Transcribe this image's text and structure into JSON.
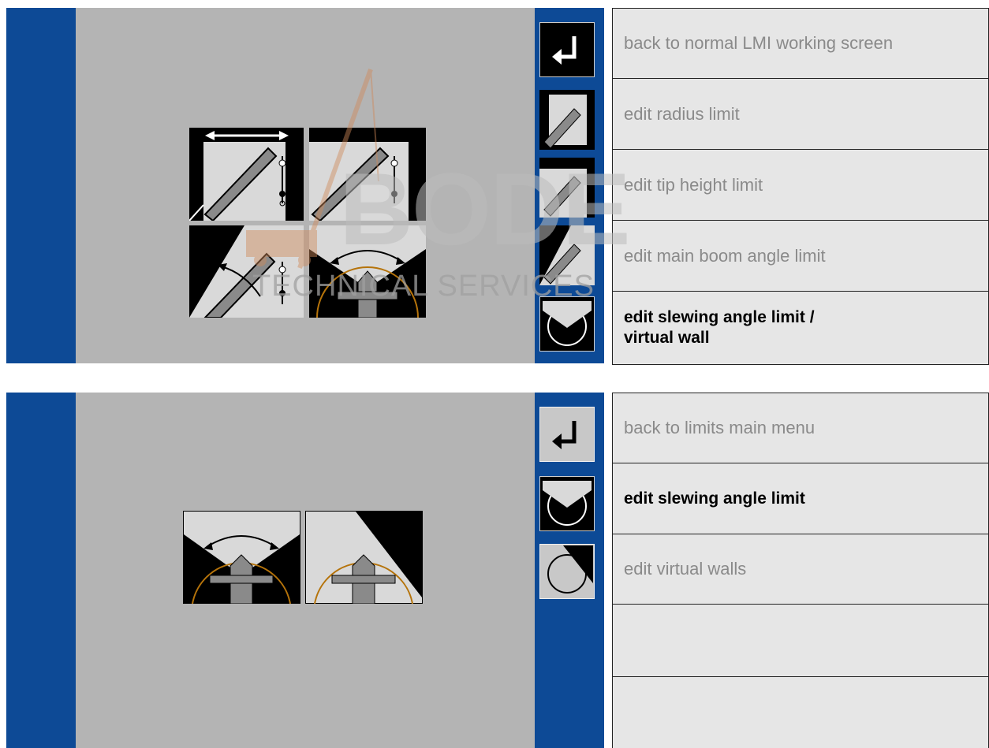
{
  "top_menu": {
    "items": [
      {
        "label": "back to normal LMI working screen",
        "icon": "return-icon",
        "bold": false
      },
      {
        "label": "edit radius limit",
        "icon": "radius-limit-icon",
        "bold": false
      },
      {
        "label": "edit tip height limit",
        "icon": "tip-height-icon",
        "bold": false
      },
      {
        "label": "edit main boom angle limit",
        "icon": "boom-angle-icon",
        "bold": false
      },
      {
        "label_line1": "edit slewing angle limit /",
        "label_line2": "virtual wall",
        "icon": "slewing-angle-icon",
        "bold": true
      }
    ]
  },
  "bottom_menu": {
    "items": [
      {
        "label": "back to limits main menu",
        "icon": "return-icon",
        "bold": false
      },
      {
        "label": "edit slewing angle limit",
        "icon": "slewing-angle-icon",
        "bold": true
      },
      {
        "label": "edit virtual walls",
        "icon": "virtual-wall-icon",
        "bold": false
      },
      {
        "label": "",
        "bold": false
      },
      {
        "label": "",
        "bold": false
      }
    ]
  },
  "watermark": {
    "line1": "BODE",
    "line2": "TECHNICAL SERVICES"
  },
  "colors": {
    "screen_blue": "#0d4a96",
    "screen_gray": "#b4b4b4",
    "row_bg": "#e6e6e6",
    "orange_arc": "#b5730a"
  }
}
